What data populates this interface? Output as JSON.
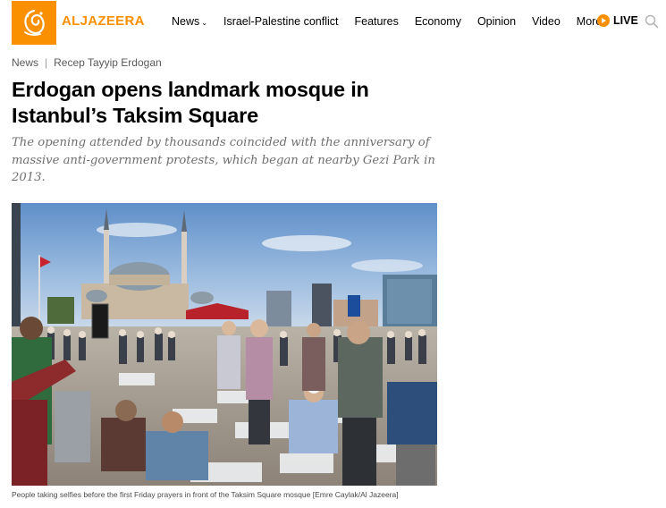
{
  "brand": {
    "logo_text": "ALJAZEERA",
    "accent_color": "#fa9000"
  },
  "nav": {
    "items": [
      {
        "label": "News",
        "has_dropdown": true
      },
      {
        "label": "Israel-Palestine conflict",
        "has_dropdown": false
      },
      {
        "label": "Features",
        "has_dropdown": false
      },
      {
        "label": "Economy",
        "has_dropdown": false
      },
      {
        "label": "Opinion",
        "has_dropdown": false
      },
      {
        "label": "Video",
        "has_dropdown": false
      },
      {
        "label": "More",
        "has_dropdown": true
      }
    ],
    "live_label": "LIVE",
    "live_icon": "play-icon",
    "search_icon": "search-icon"
  },
  "breadcrumb": {
    "items": [
      "News",
      "Recep Tayyip Erdogan"
    ],
    "separator": "|"
  },
  "article": {
    "headline": "Erdogan opens landmark mosque in Istanbul’s Taksim Square",
    "standfirst": "The opening attended by thousands coincided with the anniversary of massive anti-government protests, which began at nearby Gezi Park in 2013.",
    "image_caption": "People taking selfies before the first Friday prayers in front of the Taksim Square mosque [Emre Caylak/Al Jazeera]"
  }
}
